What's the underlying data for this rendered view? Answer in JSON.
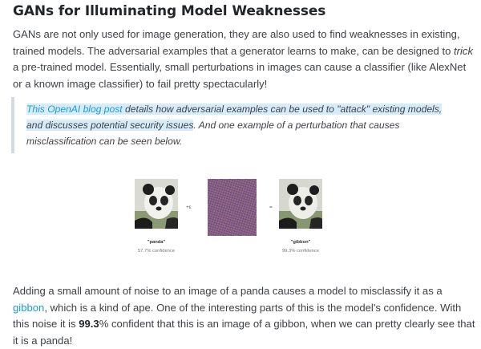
{
  "section": {
    "heading": "GANs for Illuminating Model Weaknesses",
    "intro": {
      "part1": "GANs are not only used for image generation, they are also used to find weaknesses in existing, trained models. The adversarial examples that a generator learns to make, can be designed to ",
      "emphasis": "trick",
      "part2": " a pre-trained model. Essentially, small perturbations in images can cause a classifier (like AlexNet or a known image classifier) to fail pretty spectacularly!"
    },
    "blockquote": {
      "link_text": "This OpenAI blog post",
      "highlighted_text": " details how adversarial examples can be used to \"attack\" existing models, and discusses potential security issues",
      "rest": ". And one example of a perturbation that causes misclassification can be seen below."
    },
    "figure": {
      "plus_label": "+ε",
      "equals_label": "=",
      "left_label": "\"panda\"",
      "left_confidence": "57.7% confidence",
      "right_label": "\"gibbon\"",
      "right_confidence": "99.3% confidence"
    },
    "outro": {
      "part1": "Adding a small amount of noise to an image of a panda causes a model to misclassify it as a ",
      "link_text": "gibbon",
      "part2": ", which is a kind of ape. One of the interesting parts of this is the model's confidence. With this noise it is ",
      "bold": "99.3",
      "part3": "% confident that this is an image of a gibbon, when we can pretty clearly see that it is a panda!"
    }
  },
  "colors": {
    "link": "#1a9bd7",
    "highlight": "#d7ecfa",
    "quote_border": "#d3dae3"
  }
}
